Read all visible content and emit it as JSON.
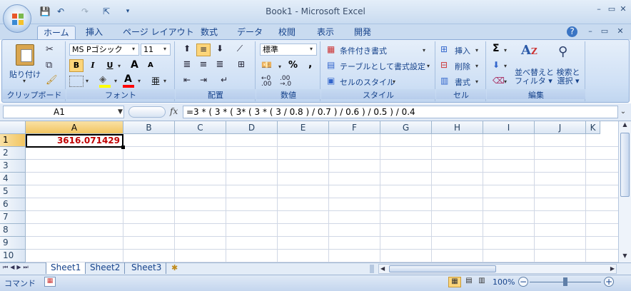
{
  "window": {
    "title": "Book1 - Microsoft Excel",
    "min": "–",
    "max": "▭",
    "close": "✕"
  },
  "tabs": [
    "ホーム",
    "挿入",
    "ページ レイアウト",
    "数式",
    "データ",
    "校閲",
    "表示",
    "開発"
  ],
  "ribbon": {
    "clipboard": {
      "label": "クリップボード",
      "paste": "貼り付け"
    },
    "font": {
      "label": "フォント",
      "name": "MS Pゴシック",
      "size": "11",
      "bold": "B",
      "italic": "I",
      "underline": "U",
      "grow": "A",
      "shrink": "A",
      "color_letter": "A",
      "phonetic": "亜"
    },
    "alignment": {
      "label": "配置"
    },
    "number": {
      "label": "数値",
      "format": "標準",
      "percent": "%",
      "comma": ","
    },
    "styles": {
      "label": "スタイル",
      "conditional": "条件付き書式",
      "table": "テーブルとして書式設定",
      "cell": "セルのスタイル"
    },
    "cells": {
      "label": "セル",
      "insert": "挿入",
      "delete": "削除",
      "format": "書式"
    },
    "editing": {
      "label": "編集",
      "sum": "Σ",
      "sort_line1": "並べ替えと",
      "sort_line2": "フィルタ",
      "find_line1": "検索と",
      "find_line2": "選択"
    }
  },
  "formula_bar": {
    "name": "A1",
    "fx": "fx",
    "formula": "=3 * ( 3 * ( 3* ( 3 * ( 3 / 0.8 ) / 0.7 ) / 0.6 ) / 0.5 ) / 0.4"
  },
  "columns": [
    "A",
    "B",
    "C",
    "D",
    "E",
    "F",
    "G",
    "H",
    "I",
    "J",
    "K"
  ],
  "rows": [
    "1",
    "2",
    "3",
    "4",
    "5",
    "6",
    "7",
    "8",
    "9",
    "10"
  ],
  "cell_a1": "3616.071429",
  "sheets": [
    "Sheet1",
    "Sheet2",
    "Sheet3"
  ],
  "status": {
    "mode": "コマンド",
    "zoom": "100%",
    "minus": "−",
    "plus": "+"
  }
}
